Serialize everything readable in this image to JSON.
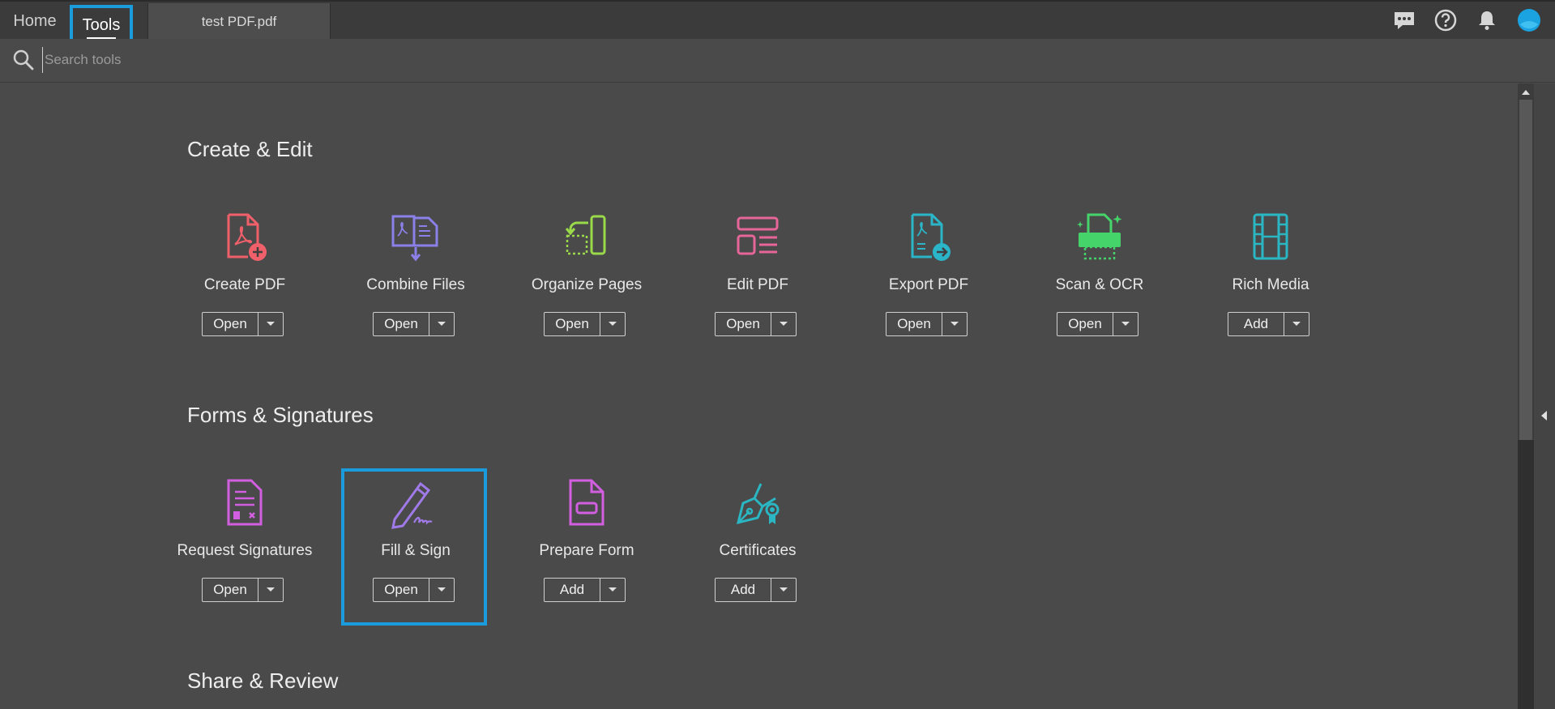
{
  "header": {
    "home_label": "Home",
    "tools_label": "Tools",
    "doc_tab_label": "test PDF.pdf",
    "icons": [
      "comment-icon",
      "help-icon",
      "bell-icon",
      "avatar"
    ]
  },
  "search": {
    "placeholder": "Search tools",
    "value": ""
  },
  "sections": [
    {
      "title": "Create & Edit",
      "tools": [
        {
          "label": "Create PDF",
          "button": "Open",
          "icon": "create-pdf-icon",
          "color": "#f0606a"
        },
        {
          "label": "Combine Files",
          "button": "Open",
          "icon": "combine-files-icon",
          "color": "#8b80e8"
        },
        {
          "label": "Organize Pages",
          "button": "Open",
          "icon": "organize-pages-icon",
          "color": "#9ad94a"
        },
        {
          "label": "Edit PDF",
          "button": "Open",
          "icon": "edit-pdf-icon",
          "color": "#e8659a"
        },
        {
          "label": "Export PDF",
          "button": "Open",
          "icon": "export-pdf-icon",
          "color": "#2bb5c8"
        },
        {
          "label": "Scan & OCR",
          "button": "Open",
          "icon": "scan-ocr-icon",
          "color": "#45d46a"
        },
        {
          "label": "Rich Media",
          "button": "Add",
          "icon": "rich-media-icon",
          "color": "#2ab6c2"
        }
      ]
    },
    {
      "title": "Forms & Signatures",
      "tools": [
        {
          "label": "Request Signatures",
          "button": "Open",
          "icon": "request-signatures-icon",
          "color": "#d25ee0"
        },
        {
          "label": "Fill & Sign",
          "button": "Open",
          "icon": "fill-sign-icon",
          "color": "#a07ae8"
        },
        {
          "label": "Prepare Form",
          "button": "Add",
          "icon": "prepare-form-icon",
          "color": "#d25ee0"
        },
        {
          "label": "Certificates",
          "button": "Add",
          "icon": "certificates-icon",
          "color": "#2ab6c2"
        }
      ]
    },
    {
      "title": "Share & Review",
      "tools": []
    }
  ],
  "colors": {
    "accent": "#1a9bdb",
    "background": "#4a4a4a",
    "topbar": "#3b3b3b"
  }
}
